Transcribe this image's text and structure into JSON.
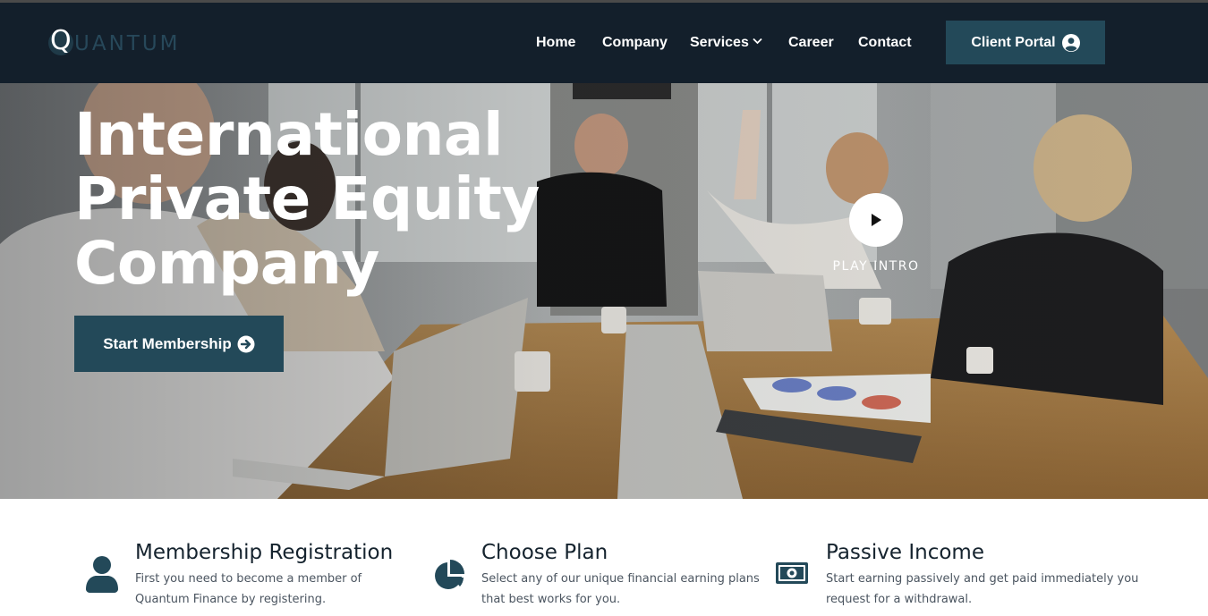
{
  "header": {
    "logo_letter": "Q",
    "logo_text": "UANTUM",
    "nav": [
      {
        "label": "Home"
      },
      {
        "label": "Company"
      },
      {
        "label": "Services",
        "has_dropdown": true
      },
      {
        "label": "Career"
      },
      {
        "label": "Contact"
      }
    ],
    "portal_label": "Client Portal",
    "portal_icon": "user-circle-icon"
  },
  "hero": {
    "title_lines": [
      "International",
      "Private Equity",
      "Company"
    ],
    "cta_label": "Start Membership",
    "cta_icon": "arrow-right-circle-icon",
    "play_label": "PLAY INTRO",
    "play_icon": "play-icon"
  },
  "features": [
    {
      "icon": "user-icon",
      "title": "Membership Registration",
      "desc_lines": [
        "First you need to become a member of",
        "Quantum Finance by registering."
      ]
    },
    {
      "icon": "pie-chart-icon",
      "title": "Choose Plan",
      "desc_lines": [
        "Select any of our unique financial earning plans",
        "that best works for you."
      ]
    },
    {
      "icon": "money-bill-icon",
      "title": "Passive Income",
      "desc_lines": [
        "Start earning passively and get paid immediately you",
        "request for a withdrawal."
      ]
    }
  ],
  "colors": {
    "header_bg": "#131f2b",
    "accent": "#234959",
    "heading": "#15232e",
    "body_text": "#4b5560"
  }
}
